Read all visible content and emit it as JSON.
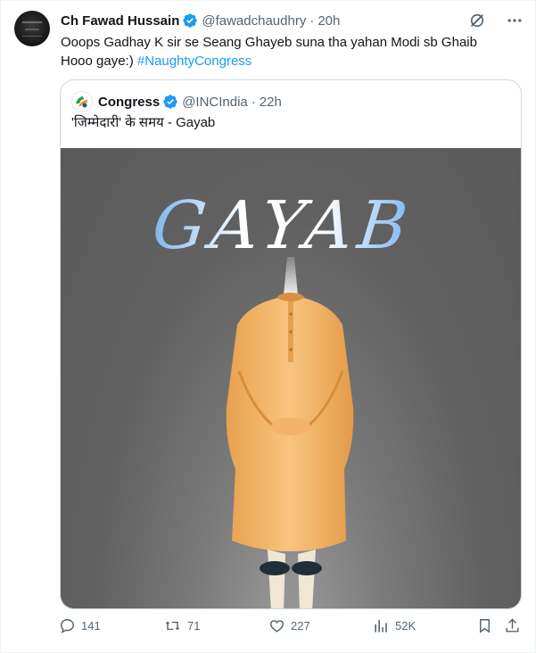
{
  "tweet": {
    "author_name": "Ch Fawad Hussain",
    "handle": "@fawadchaudhry",
    "time": "20h",
    "text": "Ooops Gadhay K sir se Seang Ghayeb  suna tha yahan Modi sb Ghaib Hooo gaye:)",
    "hashtag": "#NaughtyCongress"
  },
  "quoted": {
    "author_name": "Congress",
    "handle": "@INCIndia",
    "time": "22h",
    "text": "'जिम्मेदारी' के समय - Gayab",
    "image_text": "GAYAB"
  },
  "actions": {
    "replies": "141",
    "reposts": "71",
    "likes": "227",
    "views": "52K"
  },
  "icons": {
    "verified": "verified-badge-icon",
    "grok": "grok-icon",
    "more": "more-icon",
    "reply": "reply-icon",
    "repost": "repost-icon",
    "like": "heart-icon",
    "views": "views-icon",
    "bookmark": "bookmark-icon",
    "share": "share-icon"
  },
  "colors": {
    "accent": "#1d9bf0",
    "muted": "#536471",
    "text": "#0f1419"
  }
}
